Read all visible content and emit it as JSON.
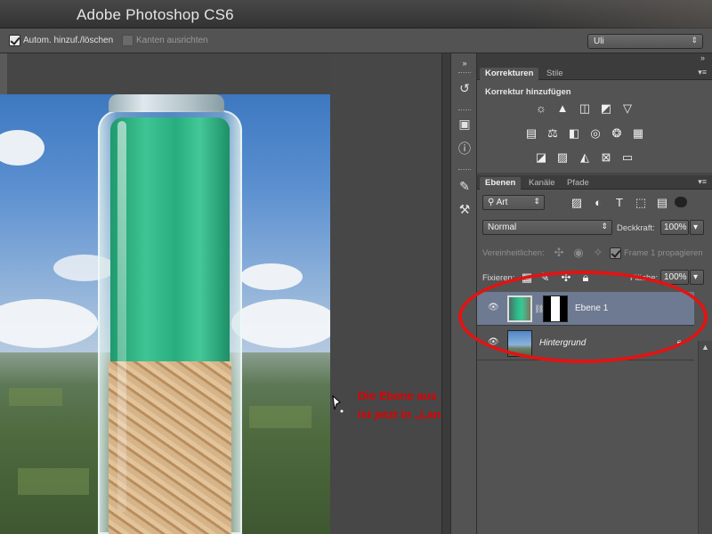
{
  "app": {
    "title": "Adobe Photoshop CS6"
  },
  "options_bar": {
    "auto_add_delete_label": "Autom. hinzuf./löschen",
    "auto_add_delete_checked": true,
    "align_edges_label": "Kanten ausrichten",
    "align_edges_checked": false,
    "workspace_value": "Uli"
  },
  "adjustments_panel": {
    "tabs": [
      "Korrekturen",
      "Stile"
    ],
    "active_tab": "Korrekturen",
    "heading": "Korrektur hinzufügen",
    "icon_rows": [
      [
        "brightness-icon",
        "levels-icon",
        "curves-icon",
        "exposure-icon",
        "vibrance-icon"
      ],
      [
        "hue-saturation-icon",
        "color-balance-icon",
        "black-white-icon",
        "photo-filter-icon",
        "channel-mixer-icon",
        "color-lookup-icon"
      ],
      [
        "invert-icon",
        "posterize-icon",
        "threshold-icon",
        "selective-color-icon",
        "gradient-map-icon"
      ]
    ]
  },
  "layers_panel": {
    "tabs": [
      "Ebenen",
      "Kanäle",
      "Pfade"
    ],
    "active_tab": "Ebenen",
    "filter_value": "Art",
    "blend_mode": "Normal",
    "opacity_label": "Deckkraft:",
    "opacity_value": "100%",
    "unify_label": "Vereinheitlichen:",
    "propagate_label": "Frame 1 propagieren",
    "lock_label": "Fixieren:",
    "fill_label": "Fläche:",
    "fill_value": "100%",
    "layers": [
      {
        "name": "Ebene 1",
        "selected": true,
        "italic": false,
        "has_mask": true,
        "locked": false
      },
      {
        "name": "Hintergrund",
        "selected": false,
        "italic": true,
        "has_mask": false,
        "locked": true
      }
    ]
  },
  "annotation": {
    "line1": "Die Ebene aus „Pastaglas.jpg“",
    "line2": "ist jetzt in „Landschaft.jpg“",
    "color": "#e00000"
  },
  "colors": {
    "ui_dark": "#535353",
    "selected_layer": "#6d7a91",
    "highlight_ellipse": "#e01414"
  }
}
